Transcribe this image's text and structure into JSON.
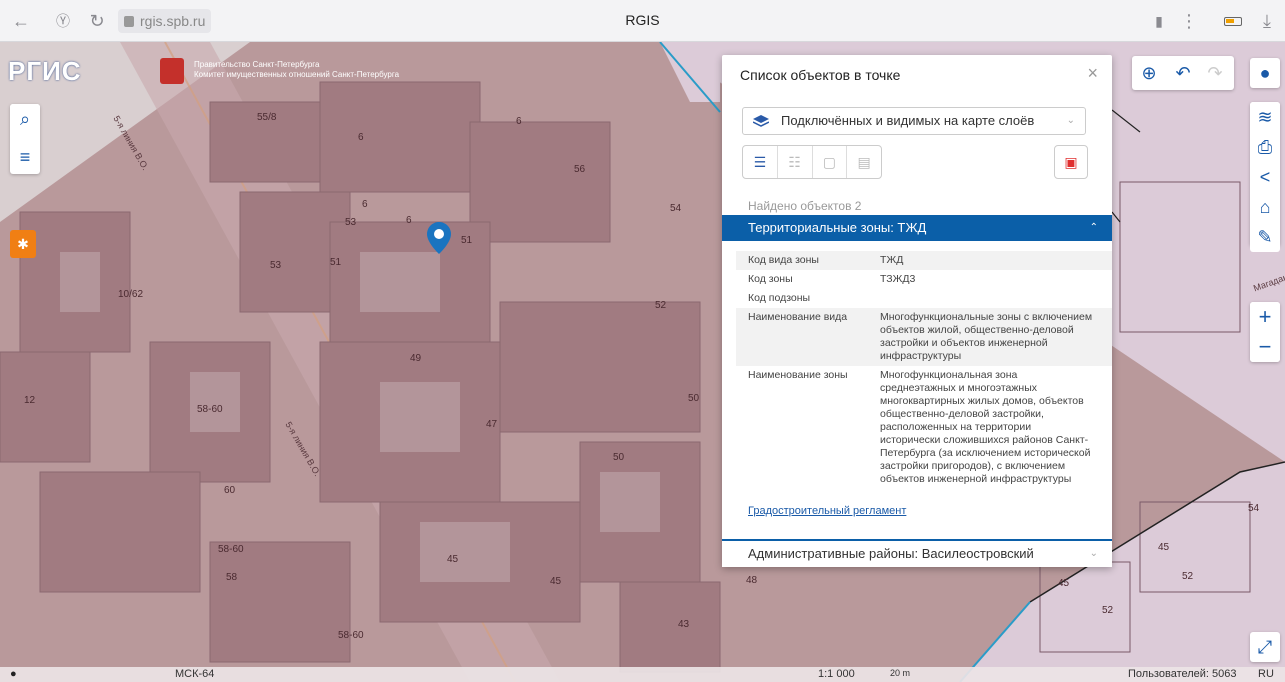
{
  "browser": {
    "url": "rgis.spb.ru",
    "tab_title": "RGIS",
    "icons": [
      "back-icon",
      "yandex-icon",
      "reload-icon",
      "lock-icon",
      "bookmark-icon",
      "menu-icon",
      "battery-icon",
      "download-icon"
    ]
  },
  "header": {
    "logo_text": "РГИС",
    "gov_line1": "Правительство Санкт-Петербурга",
    "gov_line2": "Комитет имущественных отношений Санкт-Петербурга"
  },
  "map": {
    "house_numbers": [
      "55/8",
      "6",
      "6",
      "56",
      "54",
      "6",
      "53",
      "6",
      "51",
      "53",
      "51",
      "52",
      "10/62",
      "49",
      "12",
      "58-60",
      "50",
      "47",
      "50",
      "60",
      "58-60",
      "58",
      "45",
      "45",
      "48",
      "43",
      "58-60",
      "54",
      "45",
      "52",
      "45",
      "52"
    ],
    "street_labels": [
      "5-я линия В.О.",
      "5-я линия В.О.",
      "Магадан"
    ]
  },
  "popup": {
    "title": "Список объектов в точке",
    "layer_select": "Подключённых и видимых на карте слоёв",
    "found": "Найдено объектов 2",
    "section1": "Территориальные зоны: ТЖД",
    "attributes": [
      {
        "key": "Код вида зоны",
        "value": "ТЖД"
      },
      {
        "key": "Код зоны",
        "value": "ТЗЖД3"
      },
      {
        "key": "Код подзоны",
        "value": ""
      },
      {
        "key": "Наименование вида",
        "value": "Многофункциональные зоны с включением объектов жилой, общественно-деловой застройки и объектов инженерной инфраструктуры"
      },
      {
        "key": "Наименование зоны",
        "value": "Многофункциональная зона среднеэтажных и многоэтажных многоквартирных жилых домов, объектов общественно-деловой застройки, расположенных на территории исторически сложившихся районов Санкт-Петербурга (за исключением исторической застройки пригородов), с включением объектов инженерной инфраструктуры"
      }
    ],
    "reg_link": "Градостроительный регламент",
    "section2": "Административные районы: Василеостровский"
  },
  "status": {
    "crs": "МСК-64",
    "scale": "1:1 000",
    "scale_bar": "20 m",
    "users": "Пользователей: 5063",
    "lang": "RU"
  }
}
